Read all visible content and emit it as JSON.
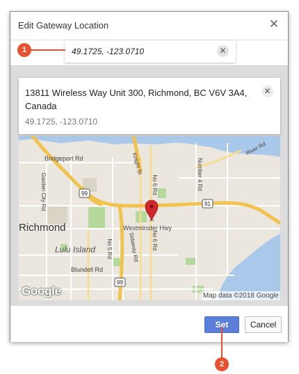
{
  "dialog": {
    "title": "Edit Gateway Location",
    "close_icon": "close-icon"
  },
  "search": {
    "value": "49.1725, -123.0710",
    "clear_icon": "clear-icon"
  },
  "info_card": {
    "address": "13811 Wireless Way Unit 300, Richmond, BC V6V 3A4, Canada",
    "coordinates": "49.1725, -123.0710",
    "clear_icon": "clear-icon"
  },
  "map": {
    "labels": {
      "bridgeport": "Bridgeport Rd",
      "garden_city": "Garden City Rd",
      "knight_st": "Knight St",
      "no6_top": "No 6 Rd",
      "number4": "Number 4 Rd",
      "river_rd": "River Rd",
      "hwy99_top": "99",
      "hwy91": "91",
      "richmond": "Richmond",
      "westminster": "Westminster Hwy",
      "lulu": "Lulu Island",
      "no5": "No 5 Rd",
      "sidaway": "Sidaway Rd",
      "no6_bottom": "No 6 Rd",
      "blundell": "Blundell Rd",
      "hwy99_bottom": "99"
    },
    "attribution": "Map data ©2018 Google",
    "logo": "Google",
    "marker_icon": "map-pin-icon"
  },
  "footer": {
    "set_label": "Set",
    "cancel_label": "Cancel"
  },
  "callouts": {
    "one": "1",
    "two": "2"
  },
  "colors": {
    "accent": "#5b7fd8",
    "callout": "#e8512f",
    "marker": "#d0282a",
    "highway": "#f2c24f",
    "water": "#a9c8ea",
    "park": "#b5d99c"
  }
}
